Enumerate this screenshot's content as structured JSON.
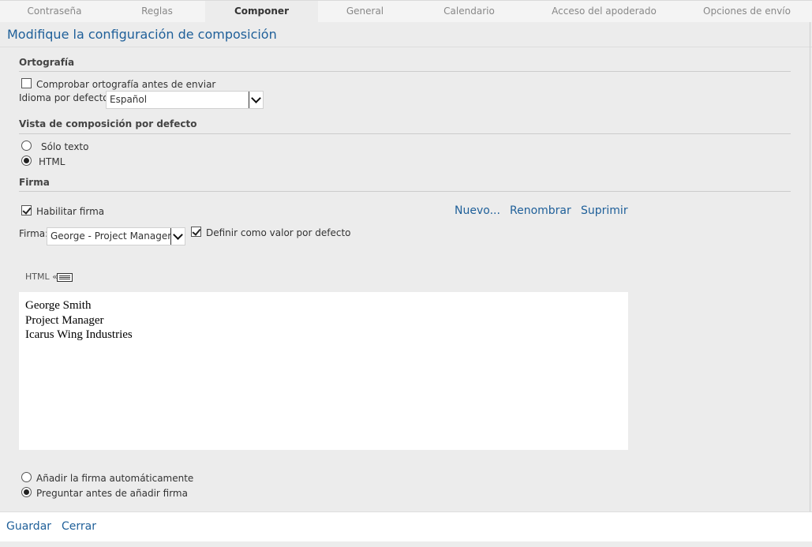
{
  "tabs": [
    {
      "label": "Contraseña",
      "active": false
    },
    {
      "label": "Reglas",
      "active": false
    },
    {
      "label": "Componer",
      "active": true
    },
    {
      "label": "General",
      "active": false
    },
    {
      "label": "Calendario",
      "active": false
    },
    {
      "label": "Acceso del apoderado",
      "active": false
    },
    {
      "label": "Opciones de envío",
      "active": false
    }
  ],
  "page_title": "Modifique la configuración de composición",
  "spelling": {
    "heading": "Ortografía",
    "check_before_send": {
      "label": "Comprobar ortografía antes de enviar",
      "checked": false
    },
    "default_language_label": "Idioma por defecto:",
    "default_language_value": "Español"
  },
  "compose_view": {
    "heading": "Vista de composición por defecto",
    "options": [
      {
        "label": "Sólo texto",
        "selected": false
      },
      {
        "label": "HTML",
        "selected": true
      }
    ]
  },
  "signature": {
    "heading": "Firma",
    "enable": {
      "label": "Habilitar firma",
      "checked": true
    },
    "actions": {
      "new": "Nuevo...",
      "rename": "Renombrar",
      "delete": "Suprimir"
    },
    "select_label": "Firma:",
    "select_value": "George - Project Manager",
    "set_default": {
      "label": "Definir como valor por defecto",
      "checked": true
    },
    "editor_mode_label": "HTML «",
    "editor_lines": [
      "George Smith",
      "Project Manager",
      "Icarus Wing Industries"
    ],
    "insert_options": [
      {
        "label": "Añadir la firma automáticamente",
        "selected": false
      },
      {
        "label": "Preguntar antes de añadir firma",
        "selected": true
      }
    ]
  },
  "footer": {
    "save": "Guardar",
    "close": "Cerrar"
  },
  "colors": {
    "accent": "#1e5f99",
    "background": "#ececec"
  }
}
